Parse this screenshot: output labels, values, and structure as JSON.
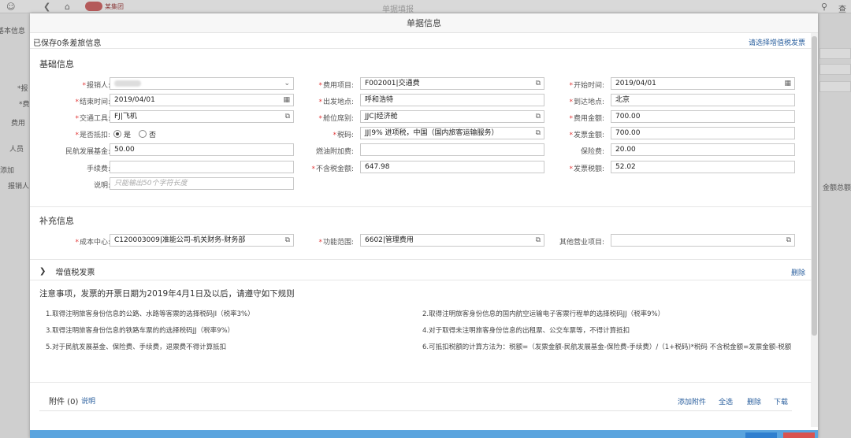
{
  "background": {
    "center_title": "单据填报",
    "logo_text": "某集团",
    "right_char": "查",
    "left_labels": [
      "基本信息",
      "*报",
      "*费",
      "费用",
      "人员",
      "添加",
      "报销人"
    ],
    "right_label": "金额总额"
  },
  "modal": {
    "title": "单据信息",
    "saved_text": "已保存0条差旅信息",
    "vat_link": "请选择增值税发票"
  },
  "basic": {
    "title": "基础信息",
    "fields": {
      "reimburser": {
        "label": "报销人:",
        "required": true
      },
      "expense_item": {
        "label": "费用项目:",
        "required": true,
        "value": "F002001|交通费"
      },
      "start_time": {
        "label": "开始时间:",
        "required": true,
        "value": "2019/04/01"
      },
      "end_time": {
        "label": "结束时间:",
        "required": true,
        "value": "2019/04/01"
      },
      "departure": {
        "label": "出发地点:",
        "required": true,
        "value": "呼和浩特"
      },
      "arrival": {
        "label": "到达地点:",
        "required": true,
        "value": "北京"
      },
      "transport": {
        "label": "交通工具:",
        "required": true,
        "value": "FJ|飞机"
      },
      "seat_class": {
        "label": "舱位席别:",
        "required": true,
        "value": "JJC|经济舱"
      },
      "expense_amount": {
        "label": "费用金额:",
        "required": true,
        "value": "700.00"
      },
      "deductible": {
        "label": "是否抵扣:",
        "required": true,
        "yes": "是",
        "no": "否"
      },
      "tax_code": {
        "label": "税码:",
        "required": true,
        "value": "JJ|9% 进项税，中国（国内旅客运输服务）"
      },
      "invoice_amount": {
        "label": "发票金额:",
        "required": true,
        "value": "700.00"
      },
      "civil_aviation_fund": {
        "label": "民航发展基金:",
        "required": false,
        "value": "50.00"
      },
      "fuel_surcharge": {
        "label": "燃油附加费:",
        "required": false,
        "value": ""
      },
      "insurance": {
        "label": "保险费:",
        "required": false,
        "value": "20.00"
      },
      "handling_fee": {
        "label": "手续费:",
        "required": false,
        "value": ""
      },
      "amount_excl_tax": {
        "label": "不含税金额:",
        "required": true,
        "value": "647.98"
      },
      "invoice_tax": {
        "label": "发票税额:",
        "required": true,
        "value": "52.02"
      },
      "description": {
        "label": "说明:",
        "required": false,
        "placeholder": "只能输出50个字符长度"
      }
    }
  },
  "supplement": {
    "title": "补充信息",
    "cost_center": {
      "label": "成本中心:",
      "required": true,
      "value": "C120003009|准能公司-机关财务-财务部"
    },
    "functional_area": {
      "label": "功能范围:",
      "required": true,
      "value": "6602|管理费用"
    },
    "other_business": {
      "label": "其他营业项目:",
      "required": false,
      "value": ""
    }
  },
  "vat": {
    "title": "增值税发票",
    "delete_label": "删除"
  },
  "notice": {
    "title": "注意事项，发票的开票日期为2019年4月1日及以后，请遵守如下规则",
    "items": [
      "1.取得注明旅客身份信息的公路、水路等客票的选择税码JI（税率3%）",
      "2.取得注明旅客身份信息的国内航空运输电子客票行程单的选择税码JJ（税率9%）",
      "3.取得注明旅客身份信息的铁路车票的的选择税码JJ（税率9%）",
      "4.对于取得未注明旅客身份信息的出租票、公交车票等，不得计算抵扣",
      "5.对于民航发展基金、保险费、手续费，退票费不得计算抵扣",
      "6.可抵扣税额的计算方法为：税额=（发票金额-民航发展基金-保险费-手续费）/（1+税码)*税码 不含税金额=发票金额-税额"
    ]
  },
  "attachments": {
    "title": "附件 (0)",
    "help": "说明",
    "actions": [
      "添加附件",
      "全选",
      "删除",
      "下载"
    ]
  }
}
